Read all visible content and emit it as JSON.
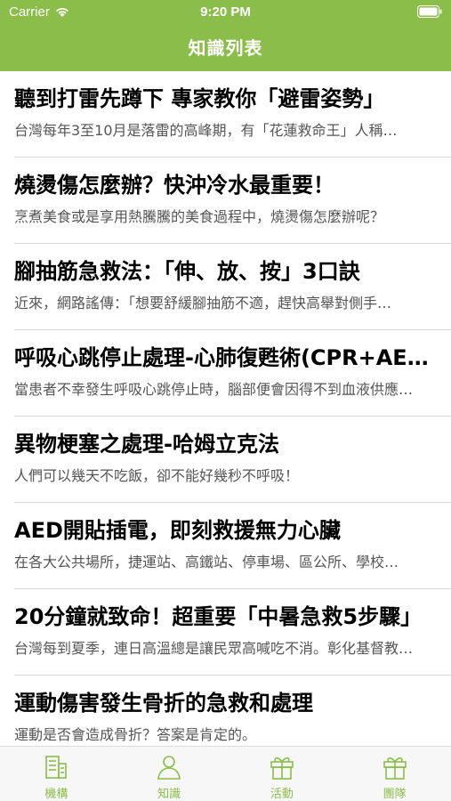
{
  "status_bar": {
    "carrier": "Carrier",
    "time": "9:20 PM",
    "wifi_icon": "wifi-icon",
    "battery_icon": "battery-icon"
  },
  "colors": {
    "accent": "#8bbd4a",
    "tab_bar_bg": "#f7f7f7",
    "divider": "#d8d8d8"
  },
  "nav": {
    "title": "知識列表"
  },
  "list": {
    "items": [
      {
        "title": "聽到打雷先蹲下 專家教你「避雷姿勢」",
        "summary": "台灣每年3至10月是落雷的高峰期，有「花蓮救命王」人稱…"
      },
      {
        "title": "燒燙傷怎麼辦？快沖冷水最重要！",
        "summary": "烹煮美食或是享用熱騰騰的美食過程中，燒燙傷怎麼辦呢？"
      },
      {
        "title": "腳抽筋急救法：「伸、放、按」3口訣",
        "summary": "近來，網路謠傳：「想要舒緩腳抽筋不適，趕快高舉對側手…"
      },
      {
        "title": "呼吸心跳停止處理-心肺復甦術(CPR+AED)",
        "summary": "當患者不幸發生呼吸心跳停止時，腦部便會因得不到血液供應…"
      },
      {
        "title": "異物梗塞之處理-哈姆立克法",
        "summary": "人們可以幾天不吃飯，卻不能好幾秒不呼吸！"
      },
      {
        "title": "AED開貼插電，即刻救援無力心臟",
        "summary": "在各大公共場所，捷運站、高鐵站、停車場、區公所、學校…"
      },
      {
        "title": "20分鐘就致命！超重要「中暑急救5步驟」",
        "summary": "台灣每到夏季，連日高溫總是讓民眾高喊吃不消。彰化基督教…"
      },
      {
        "title": "運動傷害發生骨折的急救和處理",
        "summary": "運動是否會造成骨折？答案是肯定的。"
      }
    ]
  },
  "tab_bar": {
    "tabs": [
      {
        "label": "機構",
        "icon": "building-icon"
      },
      {
        "label": "知識",
        "icon": "person-icon"
      },
      {
        "label": "活動",
        "icon": "gift-icon"
      },
      {
        "label": "團隊",
        "icon": "gift-icon"
      }
    ]
  }
}
